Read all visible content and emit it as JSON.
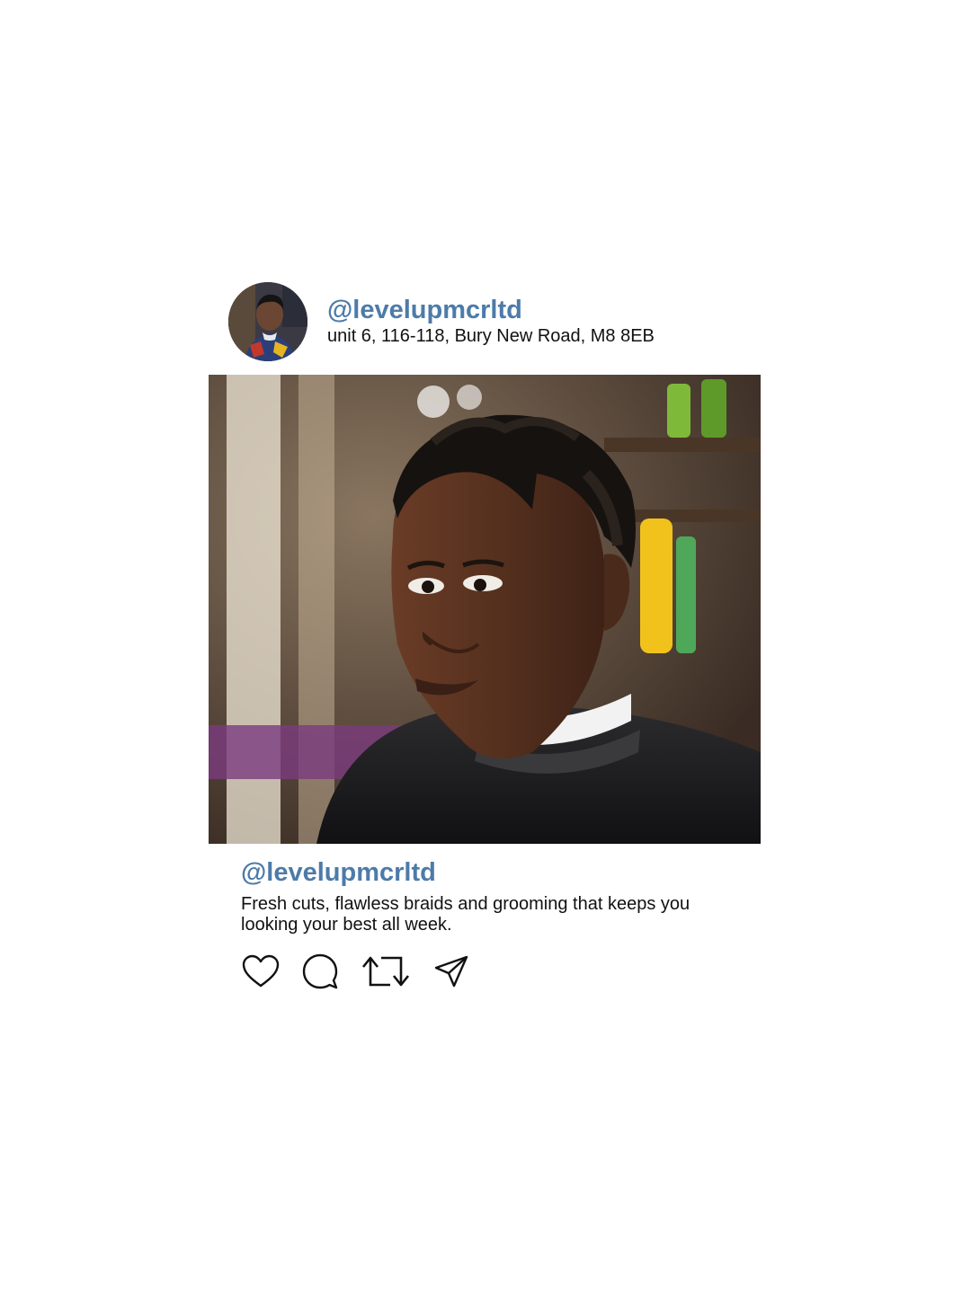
{
  "post": {
    "header": {
      "handle": "@levelupmcrltd",
      "address": "unit 6, 116-118, Bury New Road, M8 8EB",
      "avatar_icon": "profile-photo"
    },
    "photo": {
      "description_icon": "braided-hair-portrait-photo"
    },
    "caption": {
      "handle": "@levelupmcrltd",
      "text": "Fresh cuts, flawless braids and grooming that keeps you looking your best all week."
    },
    "actions": [
      {
        "name": "like",
        "icon": "heart-icon"
      },
      {
        "name": "comment",
        "icon": "comment-icon"
      },
      {
        "name": "repost",
        "icon": "repost-icon"
      },
      {
        "name": "share",
        "icon": "send-icon"
      }
    ],
    "colors": {
      "handle": "#4d7ba9",
      "text": "#111111",
      "background": "#ffffff"
    }
  }
}
